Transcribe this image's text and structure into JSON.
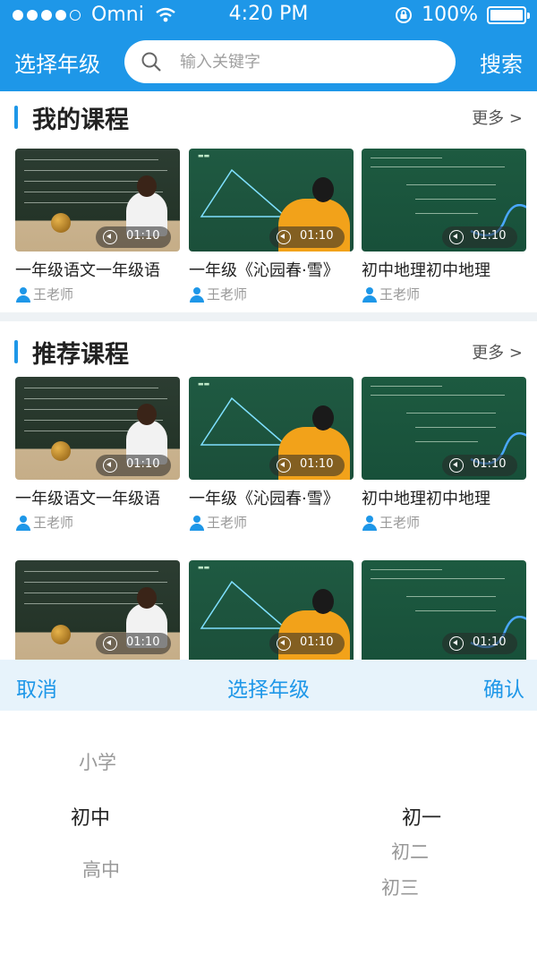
{
  "status_bar": {
    "carrier": "Omni",
    "time": "4:20 PM",
    "battery": "100%",
    "battery_level": 1.0
  },
  "header": {
    "grade_select_label": "选择年级",
    "search_placeholder": "输入关键字",
    "search_button": "搜索"
  },
  "sections": [
    {
      "title": "我的课程",
      "more_label": "更多 >",
      "courses": [
        {
          "title": "一年级语文一年级语",
          "teacher": "王老师",
          "duration": "01:10",
          "thumb": "board"
        },
        {
          "title": "一年级《沁园春·雪》",
          "teacher": "王老师",
          "duration": "01:10",
          "thumb": "green"
        },
        {
          "title": "初中地理初中地理",
          "teacher": "王老师",
          "duration": "01:10",
          "thumb": "green2"
        }
      ]
    },
    {
      "title": "推荐课程",
      "more_label": "更多 >",
      "courses": [
        {
          "title": "一年级语文一年级语",
          "teacher": "王老师",
          "duration": "01:10",
          "thumb": "board"
        },
        {
          "title": "一年级《沁园春·雪》",
          "teacher": "王老师",
          "duration": "01:10",
          "thumb": "green"
        },
        {
          "title": "初中地理初中地理",
          "teacher": "王老师",
          "duration": "01:10",
          "thumb": "green2"
        }
      ],
      "extra_row": [
        {
          "duration": "01:10",
          "thumb": "board"
        },
        {
          "duration": "01:10",
          "thumb": "green"
        },
        {
          "duration": "01:10",
          "thumb": "green2"
        }
      ]
    }
  ],
  "picker": {
    "cancel": "取消",
    "title": "选择年级",
    "confirm": "确认",
    "stage_options": [
      "小学",
      "初中",
      "高中"
    ],
    "stage_selected": "初中",
    "grade_options": [
      "初一",
      "初二",
      "初三"
    ],
    "grade_selected": "初一"
  },
  "colors": {
    "accent": "#1e97e8",
    "picker_toolbar_bg": "#e7f3fb"
  }
}
